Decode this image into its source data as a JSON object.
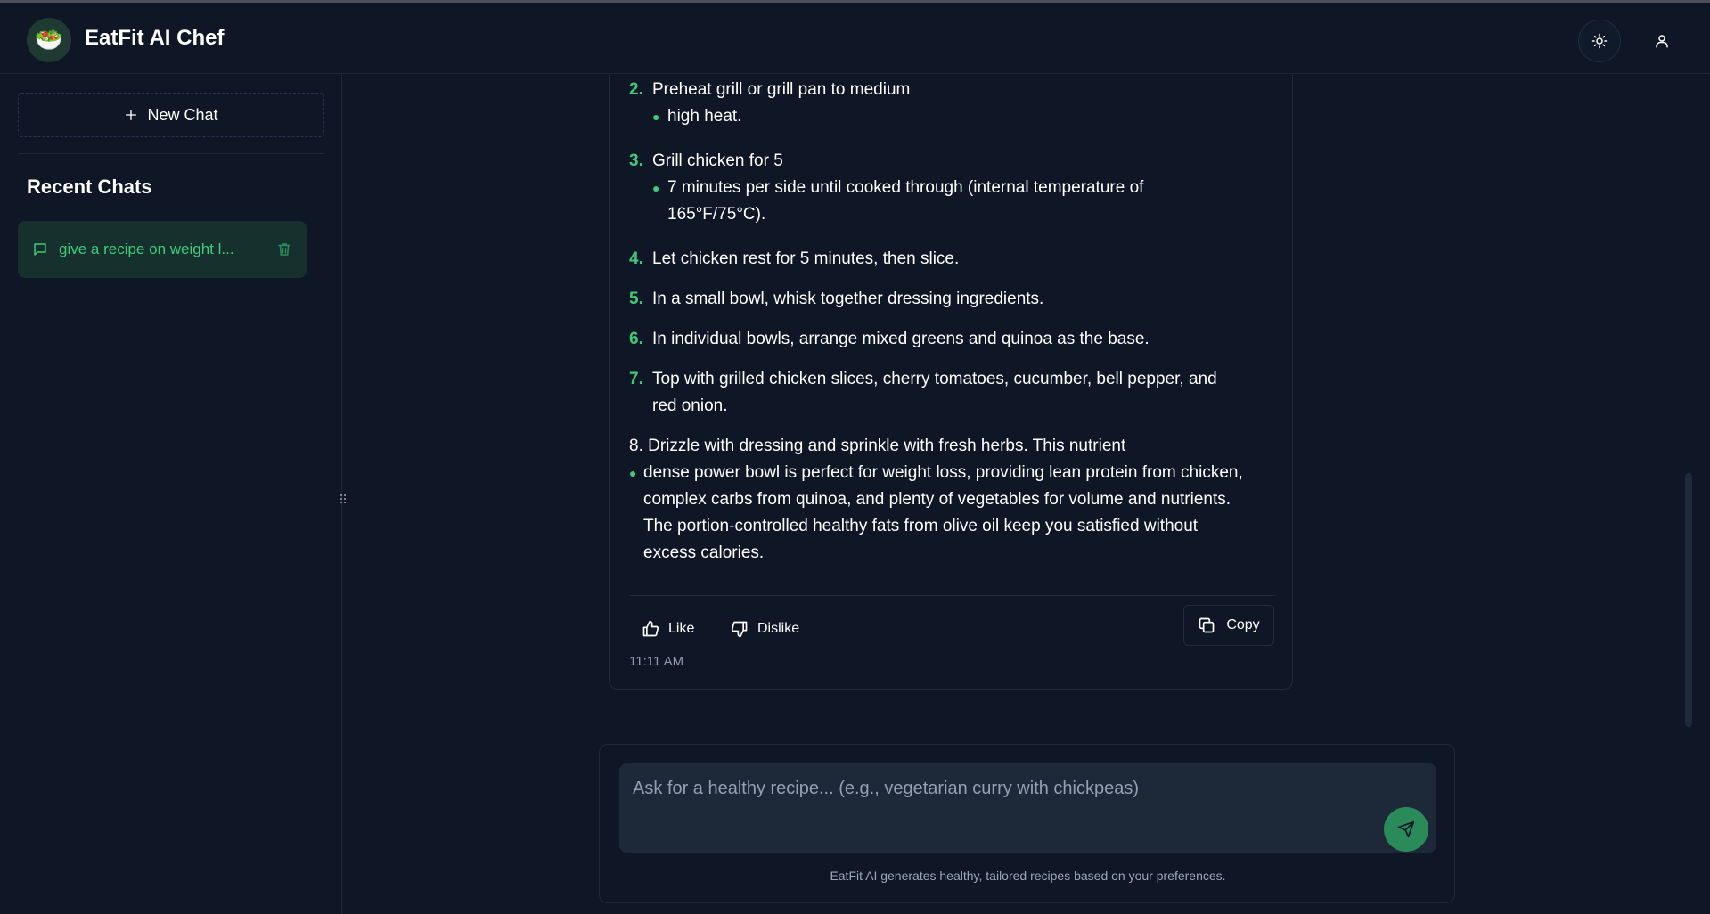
{
  "app": {
    "title": "EatFit AI Chef",
    "logo_emoji": "🥗"
  },
  "header": {
    "theme_icon": "sun-icon",
    "user_icon": "user-icon"
  },
  "sidebar": {
    "new_chat_label": "New Chat",
    "recent_title": "Recent Chats",
    "chats": [
      {
        "label": "give a recipe on weight l..."
      }
    ]
  },
  "message": {
    "steps": [
      {
        "num": "2.",
        "text": "Preheat grill or grill pan to medium",
        "sub": "high heat."
      },
      {
        "num": "3.",
        "text": "Grill chicken for 5",
        "sub_lines": [
          "7 minutes per side until cooked through (internal temperature of",
          "165°F/75°C)."
        ]
      },
      {
        "num": "4.",
        "text": "Let chicken rest for 5 minutes, then slice."
      },
      {
        "num": "5.",
        "text": "In a small bowl, whisk together dressing ingredients."
      },
      {
        "num": "6.",
        "text": "In individual bowls, arrange mixed greens and quinoa as the base."
      },
      {
        "num": "7.",
        "text_lines": [
          "Top with grilled chicken slices, cherry tomatoes, cucumber, bell pepper, and",
          "red onion."
        ]
      }
    ],
    "final_line": "8. Drizzle with dressing and sprinkle with fresh herbs. This nutrient",
    "final_bullet_lines": [
      "dense power bowl is perfect for weight loss, providing lean protein from chicken,",
      "complex carbs from quinoa, and plenty of vegetables for volume and nutrients.",
      "The portion-controlled healthy fats from olive oil keep you satisfied without",
      "excess calories."
    ],
    "like_label": "Like",
    "dislike_label": "Dislike",
    "copy_label": "Copy",
    "timestamp": "11:11 AM"
  },
  "composer": {
    "placeholder": "Ask for a healthy recipe... (e.g., vegetarian curry with chickpeas)",
    "disclaimer": "EatFit AI generates healthy, tailored recipes based on your preferences."
  },
  "colors": {
    "accent": "#3fcb7a",
    "background": "#0f1726",
    "send_button": "#2a8a5a"
  }
}
